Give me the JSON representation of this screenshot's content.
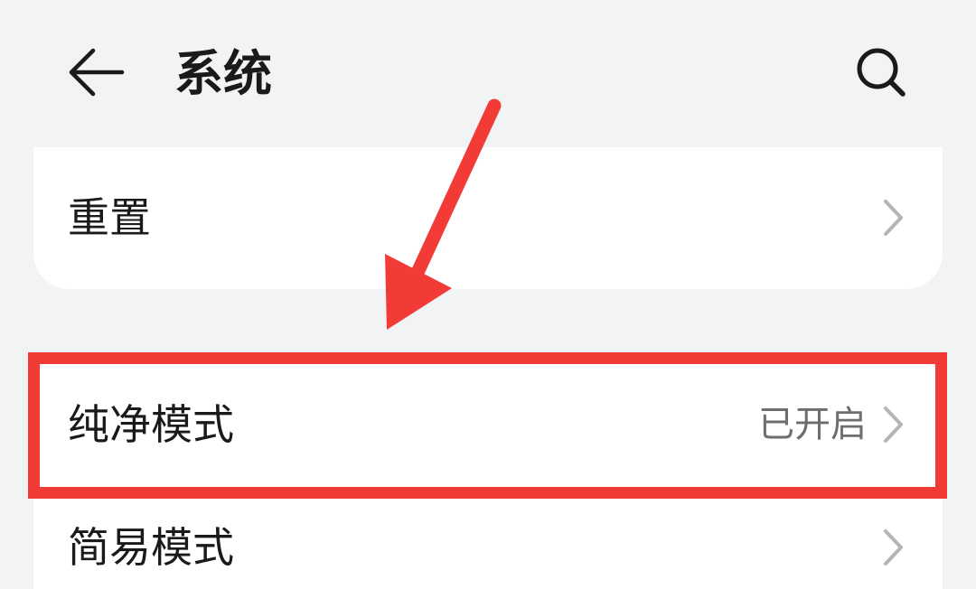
{
  "header": {
    "title": "系统"
  },
  "settings": {
    "reset_label": "重置",
    "pure_mode_label": "纯净模式",
    "pure_mode_value": "已开启",
    "simple_mode_label": "简易模式"
  },
  "colors": {
    "background": "#f1f3f5",
    "card": "#ffffff",
    "annotation_red": "#f23a36",
    "secondary_text": "#6e6e6e"
  },
  "icons": {
    "back": "back-arrow-icon",
    "search": "search-icon",
    "chevron": "chevron-right-icon"
  }
}
